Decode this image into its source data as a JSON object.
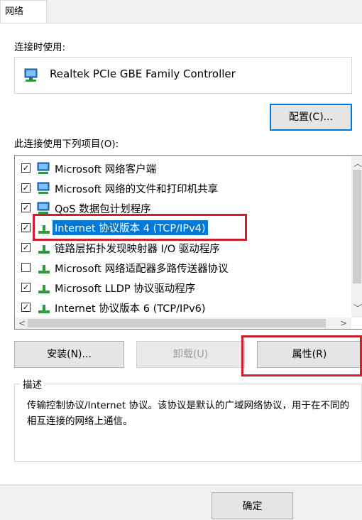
{
  "tab": {
    "label": "网络"
  },
  "connect_using": {
    "label": "连接时使用:",
    "adapter": "Realtek PCIe GBE Family Controller"
  },
  "configure_button": "配置(C)...",
  "items_label": "此连接使用下列项目(O):",
  "items": [
    {
      "label": "Microsoft 网络客户端",
      "checked": true,
      "icon": "network-client-icon"
    },
    {
      "label": "Microsoft 网络的文件和打印机共享",
      "checked": true,
      "icon": "file-printer-sharing-icon"
    },
    {
      "label": "QoS 数据包计划程序",
      "checked": true,
      "icon": "qos-scheduler-icon"
    },
    {
      "label": "Internet 协议版本 4 (TCP/IPv4)",
      "checked": true,
      "selected": true,
      "icon": "protocol-icon"
    },
    {
      "label": "链路层拓扑发现映射器 I/O 驱动程序",
      "checked": true,
      "icon": "protocol-icon"
    },
    {
      "label": "Microsoft 网络适配器多路传送器协议",
      "checked": false,
      "icon": "protocol-icon"
    },
    {
      "label": "Microsoft LLDP 协议驱动程序",
      "checked": true,
      "icon": "protocol-icon"
    },
    {
      "label": "Internet 协议版本 6 (TCP/IPv6)",
      "checked": true,
      "icon": "protocol-icon"
    }
  ],
  "buttons": {
    "install": "安装(N)...",
    "uninstall": "卸载(U)",
    "properties": "属性(R)"
  },
  "description": {
    "legend": "描述",
    "text": "传输控制协议/Internet 协议。该协议是默认的广域网络协议，用于在不同的相互连接的网络上通信。"
  },
  "ok_button": "确定",
  "colors": {
    "selection": "#0078d7",
    "highlight": "#d0202e",
    "icon_green": "#2e9a3e",
    "icon_blue": "#2f7fd0"
  }
}
